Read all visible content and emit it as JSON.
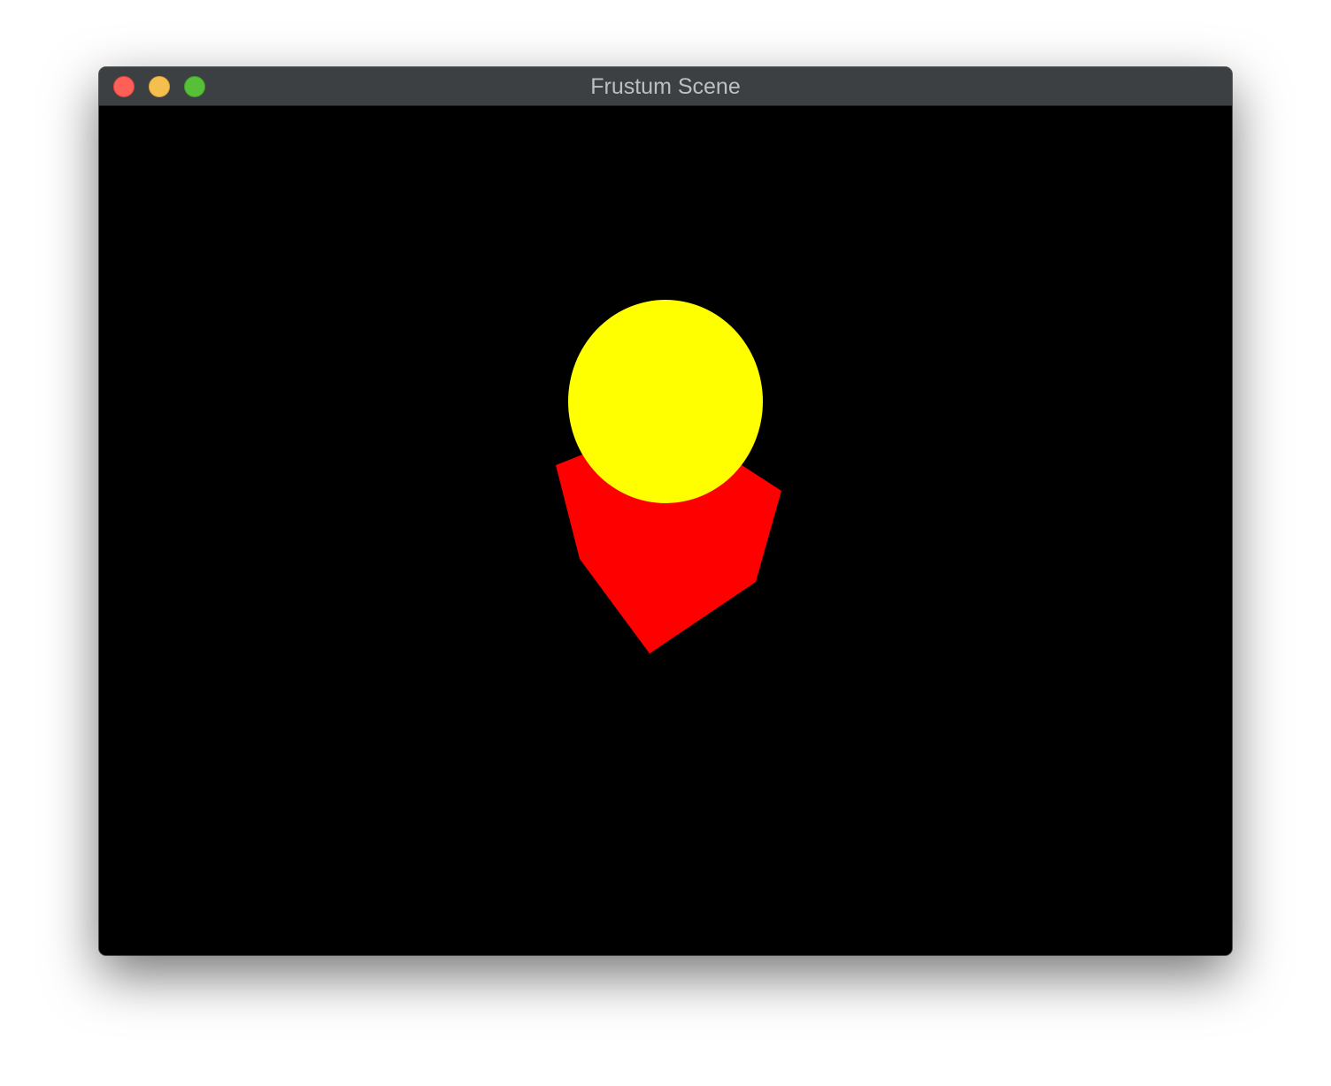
{
  "window": {
    "title": "Frustum Scene"
  },
  "scene": {
    "background_color": "#000000",
    "objects": [
      {
        "kind": "polygon",
        "color": "#ff0000"
      },
      {
        "kind": "sphere",
        "color": "#ffff00"
      }
    ]
  },
  "colors": {
    "titlebar": "#3c4043",
    "title_text": "#bdbfc1",
    "close": "#fe5f57",
    "minimize": "#f5bf4f",
    "zoom": "#57c038"
  }
}
